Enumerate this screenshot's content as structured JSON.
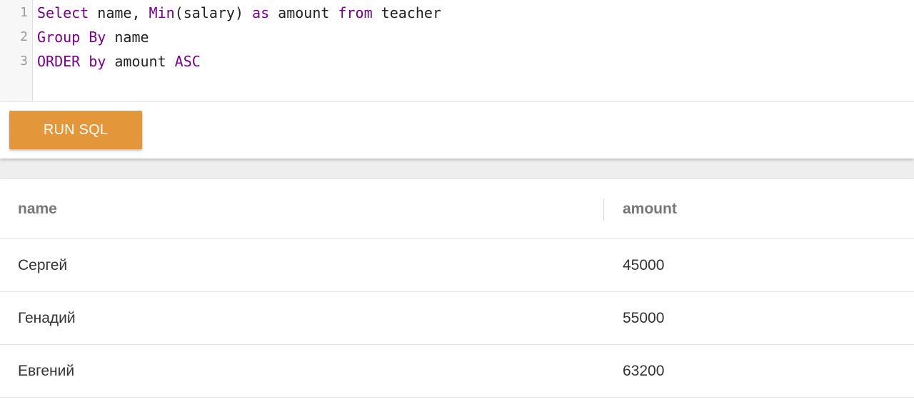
{
  "editor": {
    "line_numbers": [
      "1",
      "2",
      "3"
    ],
    "lines": [
      {
        "segments": [
          {
            "text": "Select",
            "keyword": true
          },
          {
            "text": " name, ",
            "keyword": false
          },
          {
            "text": "Min",
            "keyword": true
          },
          {
            "text": "(salary) ",
            "keyword": false
          },
          {
            "text": "as",
            "keyword": true
          },
          {
            "text": " amount ",
            "keyword": false
          },
          {
            "text": "from",
            "keyword": true
          },
          {
            "text": " teacher",
            "keyword": false
          }
        ]
      },
      {
        "segments": [
          {
            "text": "Group By",
            "keyword": true
          },
          {
            "text": " name",
            "keyword": false
          }
        ]
      },
      {
        "segments": [
          {
            "text": "ORDER by",
            "keyword": true
          },
          {
            "text": " amount ",
            "keyword": false
          },
          {
            "text": "ASC",
            "keyword": true
          }
        ]
      }
    ],
    "colors": {
      "keyword": "#770088",
      "plain": "#222222",
      "gutter_text": "#999999"
    }
  },
  "toolbar": {
    "run_label": "RUN SQL",
    "run_color": "#e4963a"
  },
  "results": {
    "columns": [
      "name",
      "amount"
    ],
    "rows": [
      [
        "Сергей",
        "45000"
      ],
      [
        "Генадий",
        "55000"
      ],
      [
        "Евгений",
        "63200"
      ]
    ]
  }
}
